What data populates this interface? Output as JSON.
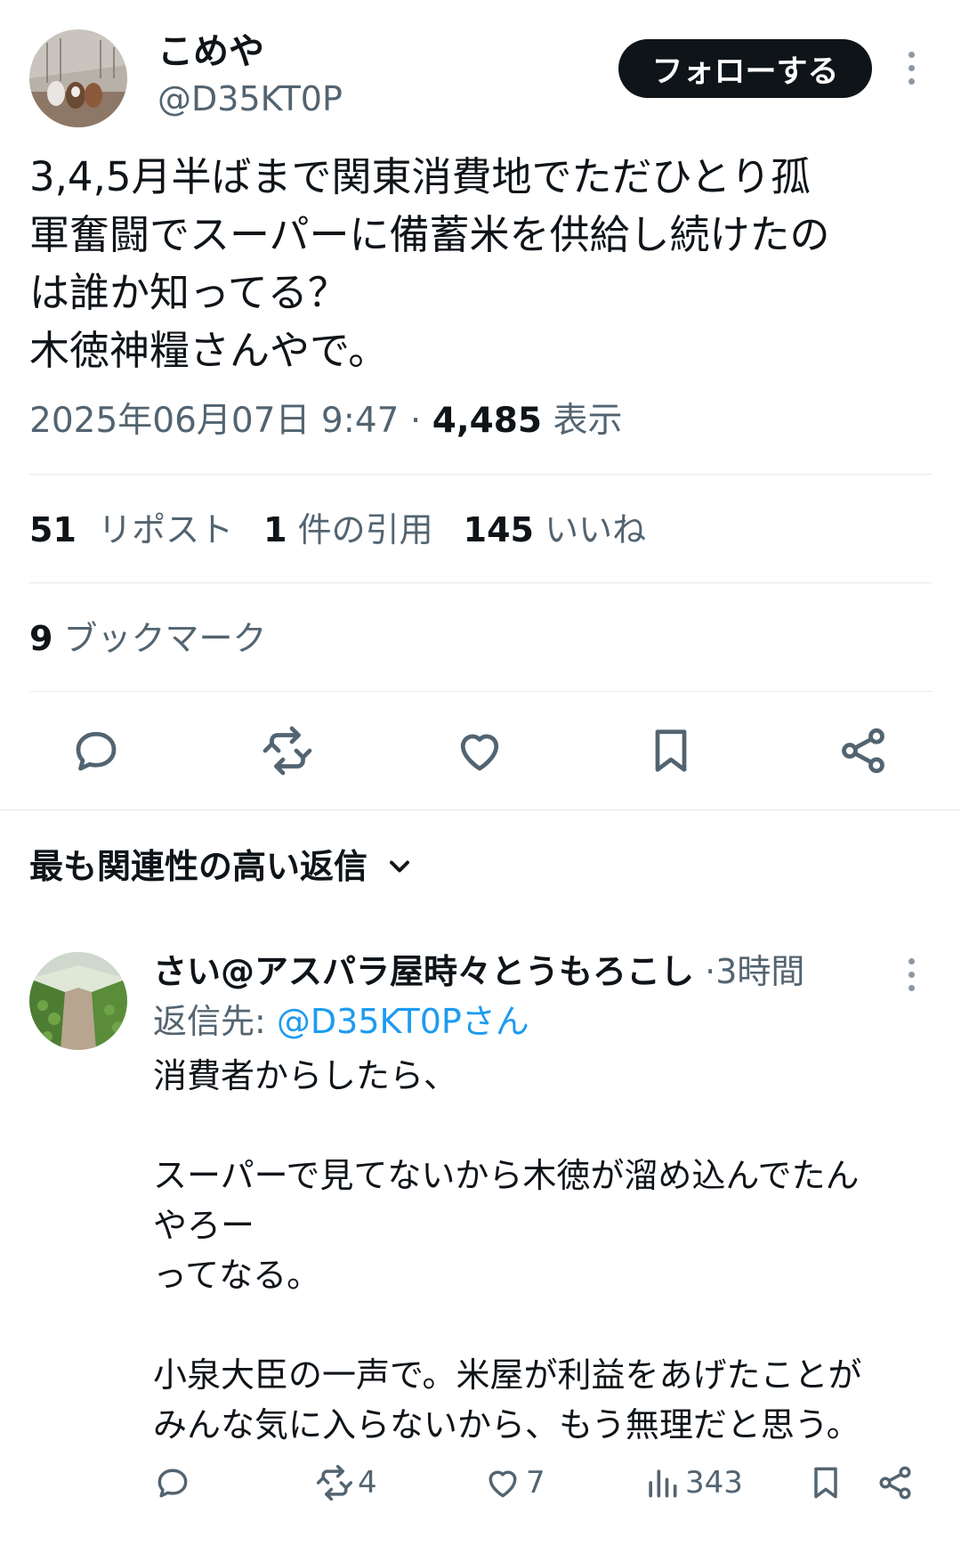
{
  "tweet": {
    "author_name": "こめや",
    "author_handle": "@D35KT0P",
    "follow_label": "フォローする",
    "text": "3,4,5月半ばまで関東消費地でただひとり孤\n軍奮闘でスーパーに備蓄米を供給し続けたの\nは誰か知ってる？\n木徳神糧さんやで。",
    "datetime": "2025年06月07日 9:47",
    "meta_separator": "·",
    "views_count": "4,485",
    "views_label": "表示"
  },
  "stats": {
    "reposts_count": "51",
    "reposts_label": "リポスト",
    "quotes_count": "1",
    "quotes_label": "件の引用",
    "likes_count": "145",
    "likes_label": "いいね",
    "bookmarks_count": "9",
    "bookmarks_label": "ブックマーク"
  },
  "actions": {
    "icons": [
      "reply-icon",
      "repost-icon",
      "like-icon",
      "bookmark-icon",
      "share-icon"
    ]
  },
  "replies_sort": {
    "label": "最も関連性の高い返信"
  },
  "reply": {
    "author_name": "さい@アスパラ屋時々とうもろこし",
    "separator": "·",
    "time": "3時間",
    "reply_to_label": "返信先:",
    "reply_to_handle": "@D35KT0Pさん",
    "text": "消費者からしたら、\n\nスーパーで見てないから木徳が溜め込んでたん\nやろー\nってなる。\n\n小泉大臣の一声で。米屋が利益をあげたことが\nみんな気に入らないから、もう無理だと思う。",
    "reposts": "4",
    "likes": "7",
    "views": "343"
  },
  "colors": {
    "text_primary": "#0f1419",
    "text_secondary": "#536471",
    "link": "#1d9bf0",
    "divider": "#e6e9eb"
  }
}
